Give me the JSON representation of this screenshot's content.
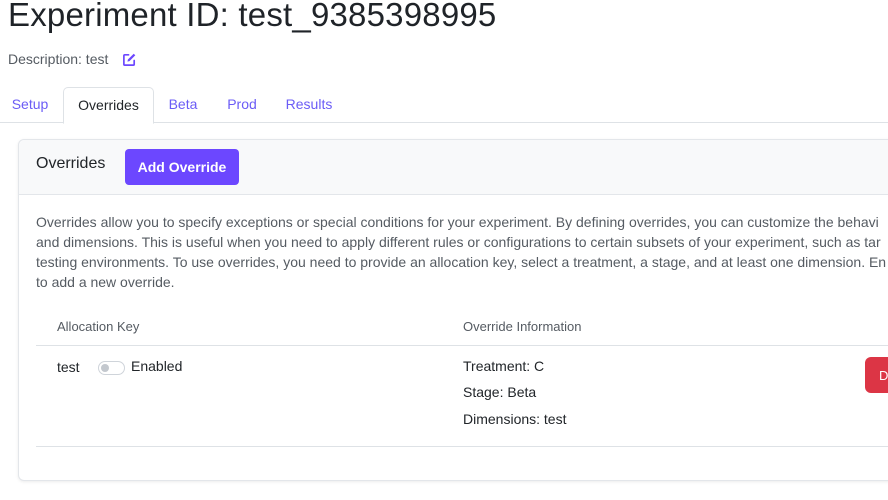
{
  "page": {
    "title": "Experiment ID: test_9385398995",
    "description": "Description: test"
  },
  "icons": {
    "edit": "edit-pencil-icon"
  },
  "tabs": [
    {
      "label": "Setup",
      "active": false
    },
    {
      "label": "Overrides",
      "active": true
    },
    {
      "label": "Beta",
      "active": false
    },
    {
      "label": "Prod",
      "active": false
    },
    {
      "label": "Results",
      "active": false
    }
  ],
  "overrides": {
    "heading": "Overrides",
    "add_button": "Add Override",
    "help_lines": [
      "Overrides allow you to specify exceptions or special conditions for your experiment. By defining overrides, you can customize the behavi",
      "and dimensions. This is useful when you need to apply different rules or configurations to certain subsets of your experiment, such as tar",
      "testing environments. To use overrides, you need to provide an allocation key, select a treatment, a stage, and at least one dimension. En",
      "to add a new override."
    ],
    "columns": {
      "allocation_key": "Allocation Key",
      "override_info": "Override Information"
    },
    "rows": [
      {
        "key": "test",
        "enabled_label": "Enabled",
        "enabled": false,
        "treatment": "Treatment: C",
        "stage": "Stage: Beta",
        "dimensions": "Dimensions: test",
        "delete_label": "D"
      }
    ]
  },
  "colors": {
    "accent": "#6c47ff",
    "tab_link": "#6b5cf6",
    "danger": "#dc3545"
  }
}
